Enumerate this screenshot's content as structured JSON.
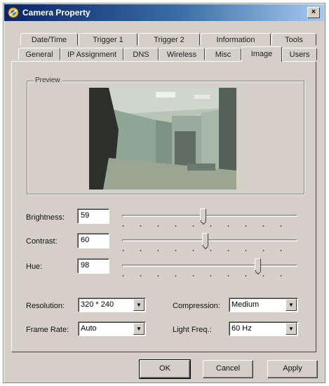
{
  "window": {
    "title": "Camera Property",
    "close_label": "×"
  },
  "tabs_row1": [
    "Date/Time",
    "Trigger 1",
    "Trigger 2",
    "Information",
    "Tools"
  ],
  "tabs_row2": [
    "General",
    "IP Assignment",
    "DNS",
    "Wireless",
    "Misc",
    "Image",
    "Users"
  ],
  "active_tab": "Image",
  "preview": {
    "label": "Preview"
  },
  "sliders": {
    "brightness": {
      "label": "Brightness:",
      "value": "59",
      "level": 0.46
    },
    "contrast": {
      "label": "Contrast:",
      "value": "60",
      "level": 0.47
    },
    "hue": {
      "label": "Hue:",
      "value": "98",
      "level": 0.77
    }
  },
  "settings": {
    "resolution": {
      "label": "Resolution:",
      "value": "320 * 240"
    },
    "compression": {
      "label": "Compression:",
      "value": "Medium"
    },
    "frame_rate": {
      "label": "Frame Rate:",
      "value": "Auto"
    },
    "light_freq": {
      "label": "Light Freq.:",
      "value": "60 Hz"
    }
  },
  "buttons": {
    "ok": "OK",
    "cancel": "Cancel",
    "apply": "Apply"
  },
  "colors": {
    "title_start": "#0a246a",
    "title_end": "#a6caf0",
    "face": "#d4d0c8"
  },
  "icons": {
    "title": "camera-icon",
    "dropdown": "chevron-down-icon"
  }
}
